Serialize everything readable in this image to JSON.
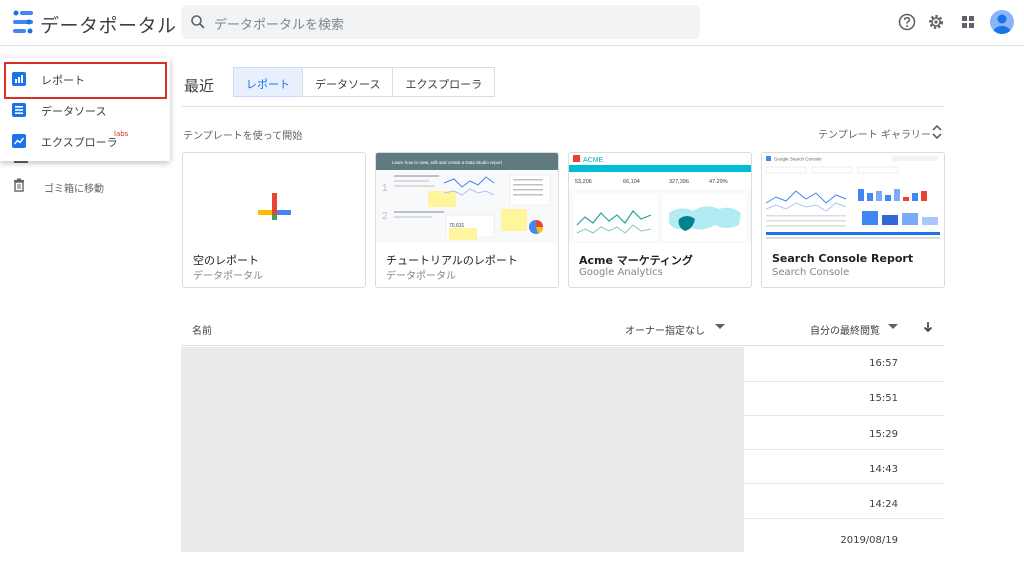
{
  "header": {
    "app_title": "データポータル",
    "search_placeholder": "データポータルを検索"
  },
  "sidebar": {
    "items": [
      {
        "label": "レポート",
        "icon": "bar-chart-icon"
      },
      {
        "label": "データソース",
        "icon": "list-icon"
      },
      {
        "label": "エクスプローラ",
        "icon": "line-chart-icon",
        "superscript": "labs"
      }
    ],
    "trash_label": "ゴミ箱に移動"
  },
  "main": {
    "recent_label": "最近",
    "tabs": [
      "レポート",
      "データソース",
      "エクスプローラ"
    ],
    "template_label": "テンプレートを使って開始",
    "gallery_label": "テンプレート ギャラリー",
    "templates": [
      {
        "title": "空のレポート",
        "subtitle": "データポータル"
      },
      {
        "title": "チュートリアルのレポート",
        "subtitle": "データポータル",
        "thumb_text": "Learn how to view, edit and create a Data Studio report"
      },
      {
        "title": "Acme マーケティング",
        "subtitle": "Google Analytics",
        "thumb_brand": "ACME",
        "thumb_stats": [
          "53,206",
          "66,104",
          "327,396",
          "47.29%"
        ]
      },
      {
        "title": "Search Console Report",
        "subtitle": "Search Console",
        "thumb_text": "Google Search Console"
      }
    ],
    "table": {
      "col_name": "名前",
      "col_owner": "オーナー指定なし",
      "col_date": "自分の最終閲覧",
      "rows": [
        "16:57",
        "15:51",
        "15:29",
        "14:43",
        "14:24",
        "2019/08/19"
      ]
    }
  },
  "colors": {
    "accent": "#1a73e8",
    "highlight": "#d93025"
  }
}
